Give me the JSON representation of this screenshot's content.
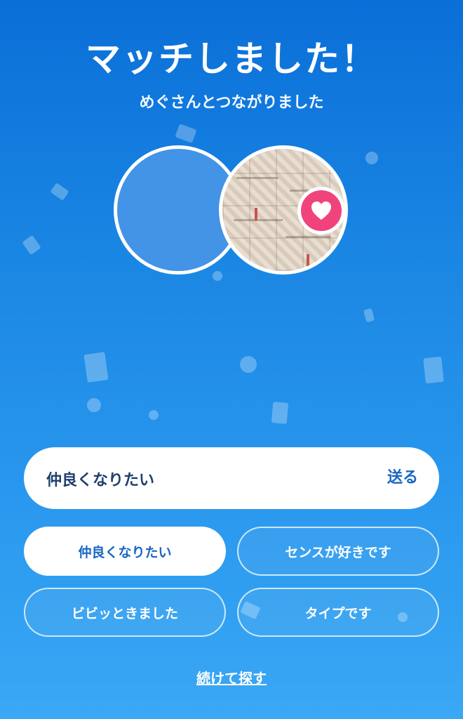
{
  "header": {
    "title": "マッチしました！",
    "subtitle": "めぐさんとつながりました"
  },
  "match": {
    "heart_icon": "heart-icon",
    "heart_color": "#f0437c"
  },
  "message": {
    "value": "仲良くなりたい",
    "send_label": "送る"
  },
  "quick_replies": [
    {
      "label": "仲良くなりたい",
      "selected": true
    },
    {
      "label": "センスが好きです",
      "selected": false
    },
    {
      "label": "ビビッときました",
      "selected": false
    },
    {
      "label": "タイプです",
      "selected": false
    }
  ],
  "footer": {
    "continue_label": "続けて探す"
  },
  "colors": {
    "background_top": "#0a6fd8",
    "background_bottom": "#3aa8f4",
    "accent": "#1866c2"
  }
}
